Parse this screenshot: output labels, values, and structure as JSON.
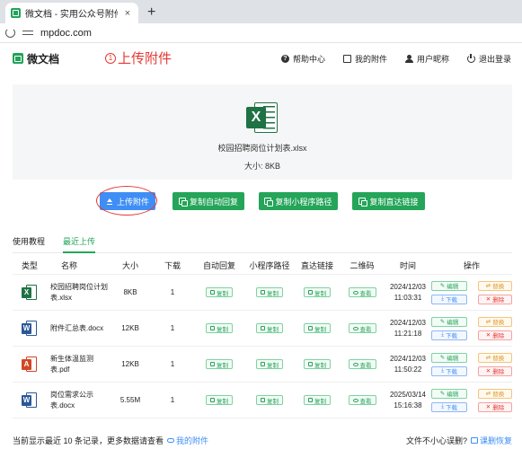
{
  "browser": {
    "tab_title": "微文档 - 实用公众号附件助手, ...",
    "close_glyph": "×",
    "new_tab_glyph": "+",
    "url": "mpdoc.com"
  },
  "header": {
    "logo_text": "微文档",
    "annotation_number": "1",
    "annotation_text": "上传附件",
    "nav": [
      {
        "label": "帮助中心",
        "icon": "help-icon"
      },
      {
        "label": "我的附件",
        "icon": "file-icon"
      },
      {
        "label": "用户昵称",
        "icon": "user-icon"
      },
      {
        "label": "退出登录",
        "icon": "power-icon"
      }
    ]
  },
  "file_card": {
    "badge_letter": "X",
    "file_name": "校园招聘岗位计划表.xlsx",
    "file_size": "大小:  8KB"
  },
  "actions": {
    "upload": "上传附件",
    "copy_auto_reply": "复制自动回复",
    "copy_mini_path": "复制小程序路径",
    "copy_direct_link": "复制直达链接"
  },
  "subtabs": {
    "tutorial": "使用教程",
    "recent": "最近上传"
  },
  "table": {
    "headers": {
      "type": "类型",
      "name": "名称",
      "size": "大小",
      "downloads": "下载",
      "auto_reply": "自动回复",
      "mini_path": "小程序路径",
      "direct_link": "直达链接",
      "qrcode": "二维码",
      "time": "时间",
      "ops": "操作"
    },
    "labels": {
      "copy": "复制",
      "view": "查看",
      "edit": "编辑",
      "replace": "替换",
      "download": "下载",
      "delete": "删除"
    },
    "rows": [
      {
        "badge": "X",
        "kind": "xls",
        "name": "校园招聘岗位计划表.xlsx",
        "size": "8KB",
        "downloads": "1",
        "time": "2024/12/03 11:03:31"
      },
      {
        "badge": "W",
        "kind": "doc",
        "name": "附件汇总表.docx",
        "size": "12KB",
        "downloads": "1",
        "time": "2024/12/03 11:21:18"
      },
      {
        "badge": "A",
        "kind": "pdf",
        "name": "新生体温监测表.pdf",
        "size": "12KB",
        "downloads": "1",
        "time": "2024/12/03 11:50:22"
      },
      {
        "badge": "W",
        "kind": "doc",
        "name": "岗位需求公示表.docx",
        "size": "5.55M",
        "downloads": "1",
        "time": "2025/03/14 15:16:38"
      }
    ]
  },
  "footer": {
    "left_text": "当前显示最近 10 条记录，更多数据请查看",
    "left_link": "我的附件",
    "right_text": "文件不小心误删?",
    "right_link": "课删恢复"
  },
  "colors": {
    "green": "#24a559",
    "blue": "#3f8ef5",
    "annotation_red": "#e53935"
  }
}
